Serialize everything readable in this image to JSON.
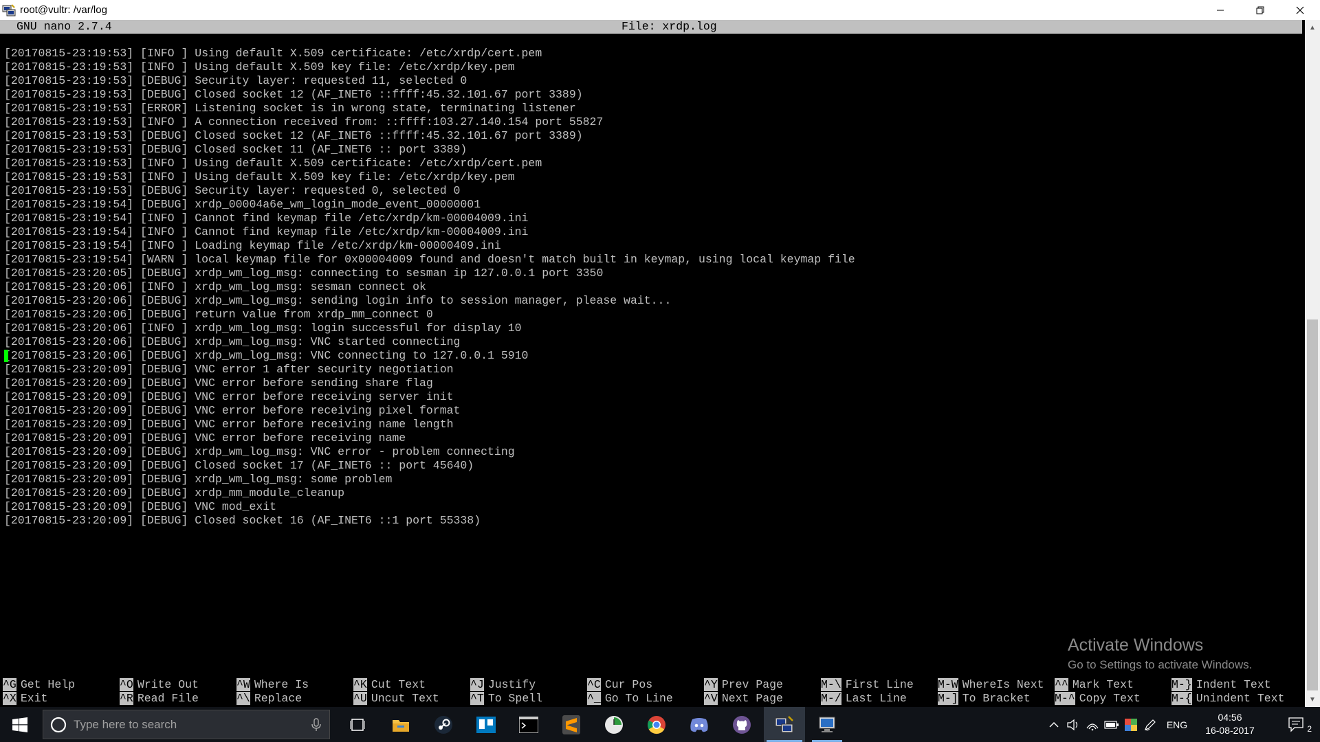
{
  "window": {
    "title": "root@vultr: /var/log",
    "buttons": [
      "minimize",
      "restore",
      "close"
    ]
  },
  "nano": {
    "version": "GNU nano 2.7.4",
    "file_label": "File: xrdp.log"
  },
  "log_lines": [
    "[20170815-23:19:53] [INFO ] Using default X.509 certificate: /etc/xrdp/cert.pem",
    "[20170815-23:19:53] [INFO ] Using default X.509 key file: /etc/xrdp/key.pem",
    "[20170815-23:19:53] [DEBUG] Security layer: requested 11, selected 0",
    "[20170815-23:19:53] [DEBUG] Closed socket 12 (AF_INET6 ::ffff:45.32.101.67 port 3389)",
    "[20170815-23:19:53] [ERROR] Listening socket is in wrong state, terminating listener",
    "[20170815-23:19:53] [INFO ] A connection received from: ::ffff:103.27.140.154 port 55827",
    "[20170815-23:19:53] [DEBUG] Closed socket 12 (AF_INET6 ::ffff:45.32.101.67 port 3389)",
    "[20170815-23:19:53] [DEBUG] Closed socket 11 (AF_INET6 :: port 3389)",
    "[20170815-23:19:53] [INFO ] Using default X.509 certificate: /etc/xrdp/cert.pem",
    "[20170815-23:19:53] [INFO ] Using default X.509 key file: /etc/xrdp/key.pem",
    "[20170815-23:19:53] [DEBUG] Security layer: requested 0, selected 0",
    "[20170815-23:19:54] [DEBUG] xrdp_00004a6e_wm_login_mode_event_00000001",
    "[20170815-23:19:54] [INFO ] Cannot find keymap file /etc/xrdp/km-00004009.ini",
    "[20170815-23:19:54] [INFO ] Cannot find keymap file /etc/xrdp/km-00004009.ini",
    "[20170815-23:19:54] [INFO ] Loading keymap file /etc/xrdp/km-00000409.ini",
    "[20170815-23:19:54] [WARN ] local keymap file for 0x00004009 found and doesn't match built in keymap, using local keymap file",
    "[20170815-23:20:05] [DEBUG] xrdp_wm_log_msg: connecting to sesman ip 127.0.0.1 port 3350",
    "[20170815-23:20:06] [INFO ] xrdp_wm_log_msg: sesman connect ok",
    "[20170815-23:20:06] [DEBUG] xrdp_wm_log_msg: sending login info to session manager, please wait...",
    "[20170815-23:20:06] [DEBUG] return value from xrdp_mm_connect 0",
    "[20170815-23:20:06] [INFO ] xrdp_wm_log_msg: login successful for display 10",
    "[20170815-23:20:06] [DEBUG] xrdp_wm_log_msg: VNC started connecting",
    "[20170815-23:20:06] [DEBUG] xrdp_wm_log_msg: VNC connecting to 127.0.0.1 5910",
    "[20170815-23:20:09] [DEBUG] VNC error 1 after security negotiation",
    "[20170815-23:20:09] [DEBUG] VNC error before sending share flag",
    "[20170815-23:20:09] [DEBUG] VNC error before receiving server init",
    "[20170815-23:20:09] [DEBUG] VNC error before receiving pixel format",
    "[20170815-23:20:09] [DEBUG] VNC error before receiving name length",
    "[20170815-23:20:09] [DEBUG] VNC error before receiving name",
    "[20170815-23:20:09] [DEBUG] xrdp_wm_log_msg: VNC error - problem connecting",
    "[20170815-23:20:09] [DEBUG] Closed socket 17 (AF_INET6 :: port 45640)",
    "[20170815-23:20:09] [DEBUG] xrdp_wm_log_msg: some problem",
    "[20170815-23:20:09] [DEBUG] xrdp_mm_module_cleanup",
    "[20170815-23:20:09] [DEBUG] VNC mod_exit",
    "[20170815-23:20:09] [DEBUG] Closed socket 16 (AF_INET6 ::1 port 55338)"
  ],
  "shortcuts_row1": [
    {
      "key": "^G",
      "label": "Get Help"
    },
    {
      "key": "^O",
      "label": "Write Out"
    },
    {
      "key": "^W",
      "label": "Where Is"
    },
    {
      "key": "^K",
      "label": "Cut Text"
    },
    {
      "key": "^J",
      "label": "Justify"
    },
    {
      "key": "^C",
      "label": "Cur Pos"
    },
    {
      "key": "^Y",
      "label": "Prev Page"
    },
    {
      "key": "M-\\",
      "label": "First Line"
    },
    {
      "key": "M-W",
      "label": "WhereIs Next"
    },
    {
      "key": "^^",
      "label": "Mark Text"
    },
    {
      "key": "M-}",
      "label": "Indent Text"
    }
  ],
  "shortcuts_row2": [
    {
      "key": "^X",
      "label": "Exit"
    },
    {
      "key": "^R",
      "label": "Read File"
    },
    {
      "key": "^\\",
      "label": "Replace"
    },
    {
      "key": "^U",
      "label": "Uncut Text"
    },
    {
      "key": "^T",
      "label": "To Spell"
    },
    {
      "key": "^_",
      "label": "Go To Line"
    },
    {
      "key": "^V",
      "label": "Next Page"
    },
    {
      "key": "M-/",
      "label": "Last Line"
    },
    {
      "key": "M-]",
      "label": "To Bracket"
    },
    {
      "key": "M-^",
      "label": "Copy Text"
    },
    {
      "key": "M-{",
      "label": "Unindent Text"
    }
  ],
  "watermark": {
    "line1": "Activate Windows",
    "line2": "Go to Settings to activate Windows."
  },
  "taskbar": {
    "search_placeholder": "Type here to search",
    "apps": [
      "task-view-icon",
      "file-explorer-icon",
      "steam-icon",
      "trello-icon",
      "terminal-icon",
      "sublime-text-icon",
      "clock-app-icon",
      "chrome-icon",
      "discord-icon",
      "github-icon",
      "putty-icon",
      "remote-desktop-icon"
    ],
    "language": "ENG",
    "time": "04:56",
    "date": "16-08-2017",
    "notification_count": "2"
  },
  "colors": {
    "terminal_bg": "#000000",
    "terminal_fg": "#c0c0c0",
    "cursor": "#00ff00",
    "taskbar_bg": "#101318"
  }
}
